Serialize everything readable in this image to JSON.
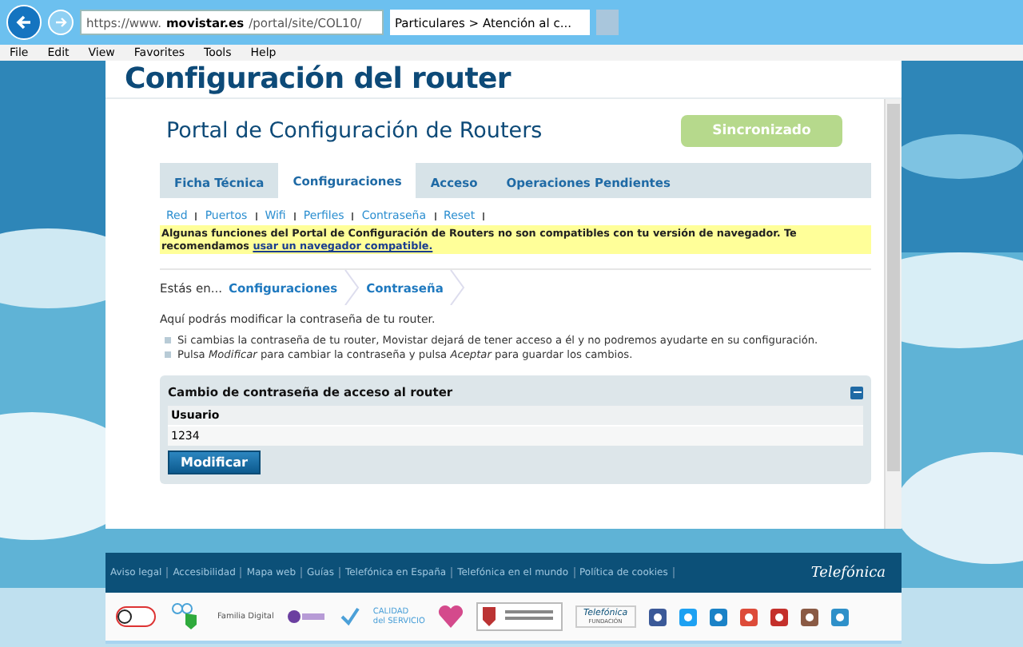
{
  "browser": {
    "url_prefix": "https://www.",
    "url_domain": "movistar.es",
    "url_rest": "/portal/site/COL10/",
    "tab_title": "Particulares > Atención al c...",
    "menu": [
      "File",
      "Edit",
      "View",
      "Favorites",
      "Tools",
      "Help"
    ]
  },
  "page_title": "Configuración del router",
  "portal_title": "Portal de Configuración de Routers",
  "status_button": "Sincronizado",
  "tabs": [
    {
      "label": "Ficha Técnica",
      "selected": false
    },
    {
      "label": "Configuraciones",
      "selected": true
    },
    {
      "label": "Acceso",
      "selected": false
    },
    {
      "label": "Operaciones Pendientes",
      "selected": false
    }
  ],
  "subnav": [
    "Red",
    "Puertos",
    "Wifi",
    "Perfiles",
    "Contraseña",
    "Reset"
  ],
  "notice": {
    "text": "Algunas funciones del Portal de Configuración de Routers no son compatibles con tu versión de navegador. Te recomendamos",
    "link": "usar un navegador compatible."
  },
  "breadcrumb": {
    "prefix": "Estás en...",
    "items": [
      "Configuraciones",
      "Contraseña"
    ]
  },
  "intro": "Aquí podrás modificar la contraseña de tu router.",
  "bullets": [
    "Si cambias la contraseña de tu router, Movistar dejará de tener acceso a él y no podremos ayudarte en su configuración.",
    "Pulsa *Modificar* para cambiar la contraseña y pulsa *Aceptar* para guardar los cambios."
  ],
  "panel": {
    "title": "Cambio de contraseña de acceso al router",
    "expanded": true,
    "field_label": "Usuario",
    "field_value": "1234",
    "button": "Modificar"
  },
  "footer": {
    "links": [
      "Aviso legal",
      "Accesibilidad",
      "Mapa web",
      "Guías",
      "Telefónica en España",
      "Telefónica en el mundo",
      "Política de cookies"
    ],
    "brand": "Telefónica",
    "familia": "Familia Digital",
    "calidad_top": "CALIDAD",
    "calidad_bottom": "del SERVICIO",
    "fundacion_top": "Telefónica",
    "fundacion_bottom": "FUNDACIÓN"
  }
}
